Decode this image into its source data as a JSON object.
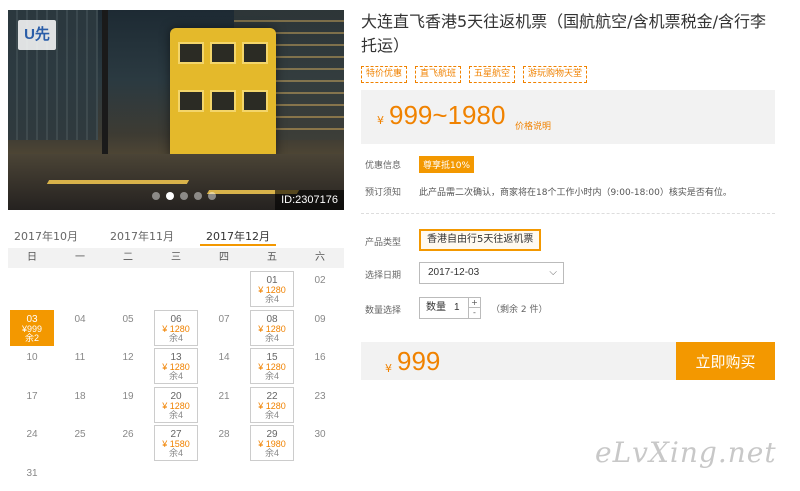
{
  "photo": {
    "logo_text": "U先",
    "image_id": "ID:2307176",
    "slide_count": 5,
    "active_slide": 1
  },
  "calendar": {
    "months": [
      "2017年10月",
      "2017年11月",
      "2017年12月"
    ],
    "active_month": "2017年12月",
    "weekdays": [
      "日",
      "一",
      "二",
      "三",
      "四",
      "五",
      "六"
    ],
    "weeks": [
      [
        null,
        null,
        null,
        null,
        null,
        {
          "d": "01",
          "p": "¥ 1280",
          "s": "余4"
        },
        {
          "d": "02"
        }
      ],
      [
        {
          "d": "03",
          "p": "¥999",
          "s": "余2",
          "sel": true
        },
        {
          "d": "04"
        },
        {
          "d": "05"
        },
        {
          "d": "06",
          "p": "¥ 1280",
          "s": "余4"
        },
        {
          "d": "07"
        },
        {
          "d": "08",
          "p": "¥ 1280",
          "s": "余4"
        },
        {
          "d": "09"
        }
      ],
      [
        {
          "d": "10"
        },
        {
          "d": "11"
        },
        {
          "d": "12"
        },
        {
          "d": "13",
          "p": "¥ 1280",
          "s": "余4"
        },
        {
          "d": "14"
        },
        {
          "d": "15",
          "p": "¥ 1280",
          "s": "余4"
        },
        {
          "d": "16"
        }
      ],
      [
        {
          "d": "17"
        },
        {
          "d": "18"
        },
        {
          "d": "19"
        },
        {
          "d": "20",
          "p": "¥ 1280",
          "s": "余4"
        },
        {
          "d": "21"
        },
        {
          "d": "22",
          "p": "¥ 1280",
          "s": "余4"
        },
        {
          "d": "23"
        }
      ],
      [
        {
          "d": "24"
        },
        {
          "d": "25"
        },
        {
          "d": "26"
        },
        {
          "d": "27",
          "p": "¥ 1580",
          "s": "余4"
        },
        {
          "d": "28"
        },
        {
          "d": "29",
          "p": "¥ 1980",
          "s": "余4"
        },
        {
          "d": "30"
        }
      ],
      [
        {
          "d": "31"
        },
        null,
        null,
        null,
        null,
        null,
        null
      ]
    ]
  },
  "product": {
    "title": "大连直飞香港5天往返机票（国航航空/含机票税金/含行李托运）",
    "tags": [
      "特价优惠",
      "直飞航班",
      "五星航空",
      "游玩购物天堂"
    ],
    "currency": "¥",
    "price_range": "999~1980",
    "price_explain": "价格说明",
    "promo_label": "优惠信息",
    "promo_badge": "尊享抵10%",
    "notice_label": "预订须知",
    "notice_text": "此产品需二次确认，商家将在18个工作小时内（9:00-18:00）核实是否有位。",
    "type_label": "产品类型",
    "type_value": "香港自由行5天往返机票",
    "date_label": "选择日期",
    "date_value": "2017-12-03",
    "qty_label": "数量选择",
    "qty_prefix": "数量",
    "qty_value": "1",
    "qty_plus": "+",
    "qty_minus": "-",
    "remaining": "（剩余 2 件）",
    "total_price": "999",
    "buy_label": "立即购买"
  },
  "watermark": "eLvXing.net",
  "colors": {
    "accent": "#f39800",
    "price": "#f08200"
  }
}
